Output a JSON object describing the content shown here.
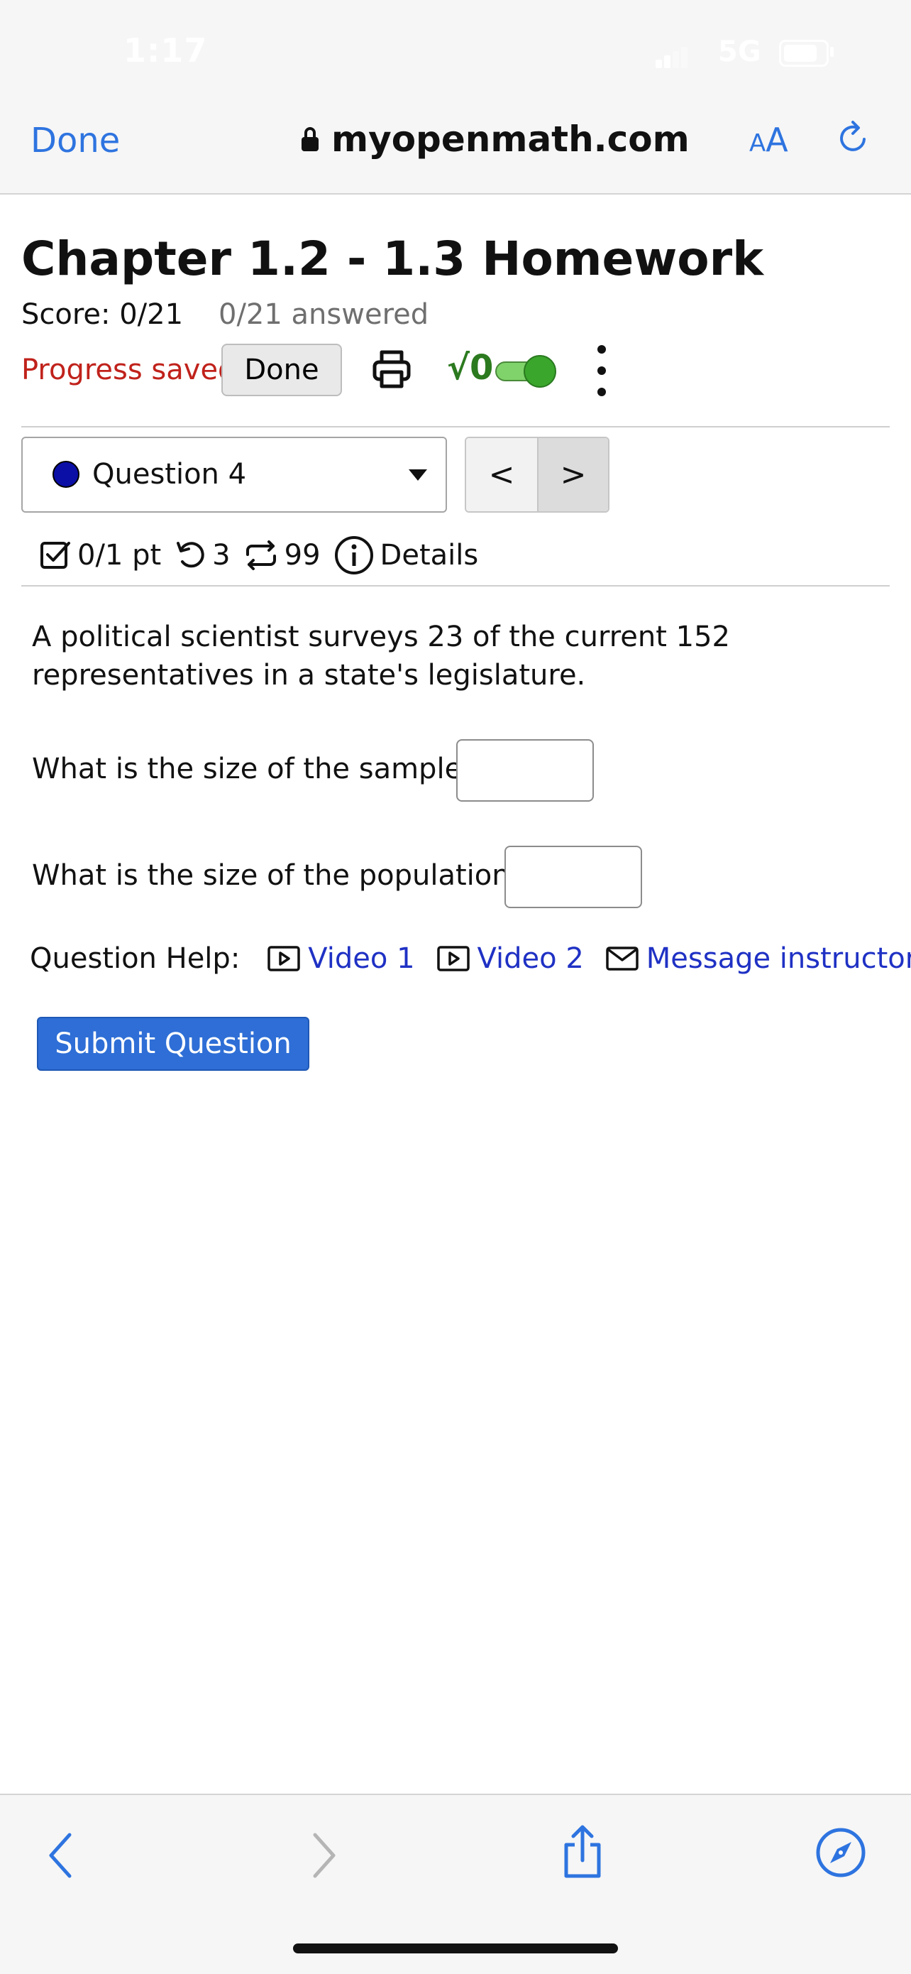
{
  "status_bar": {
    "time": "1:17",
    "network": "5G"
  },
  "browser": {
    "done_label": "Done",
    "url": "myopenmath.com",
    "text_size_label_small": "A",
    "text_size_label_large": "A"
  },
  "page": {
    "title": "Chapter 1.2 - 1.3 Homework",
    "score": "Score: 0/21",
    "answered": "0/21 answered",
    "progress_saved": "Progress saved",
    "done_button": "Done",
    "sqrt_label": "√0",
    "question_select": "Question 4",
    "prev_label": "<",
    "next_label": ">",
    "points": "0/1 pt",
    "retries": "3",
    "versions": "99",
    "details": "Details",
    "problem_text": "A political scientist surveys 23 of the current 152 representatives in a state's legislature.",
    "sample_prompt": "What is the size of the sample:",
    "sample_value": "",
    "population_prompt": "What is the size of the population:",
    "population_value": "",
    "help_label": "Question Help:",
    "video1": "Video 1",
    "video2": "Video 2",
    "message_instructor": "Message instructor",
    "submit": "Submit Question"
  },
  "colors": {
    "link_blue": "#2e74e0",
    "help_link": "#1f31c4",
    "progress_red": "#c0221b",
    "submit_blue": "#2e6ed6",
    "toggle_green": "#3aa62c",
    "question_dot": "#0b0fa6"
  },
  "icons": {
    "lock": "lock-icon",
    "reload": "reload-icon",
    "print": "printer-icon",
    "kebab": "more-vertical-icon",
    "points": "checkbox-icon",
    "retries": "undo-icon",
    "versions": "repeat-icon",
    "details": "info-icon",
    "video": "play-icon",
    "message": "mail-icon",
    "back": "chevron-left-icon",
    "forward": "chevron-right-icon",
    "share": "share-icon",
    "compass": "compass-icon"
  }
}
